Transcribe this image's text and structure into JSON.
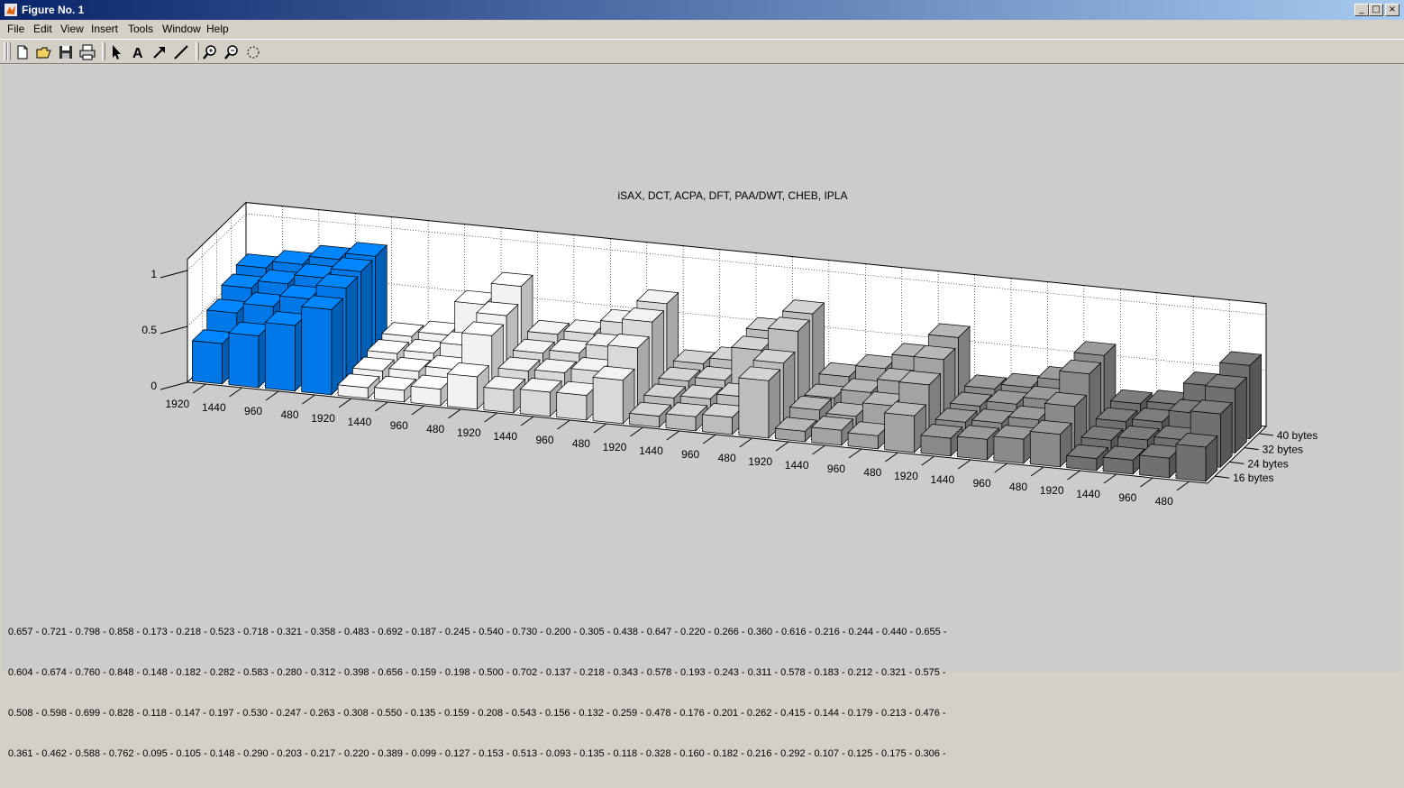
{
  "window": {
    "title": "Figure No. 1"
  },
  "menu": [
    "File",
    "Edit",
    "View",
    "Insert",
    "Tools",
    "Window",
    "Help"
  ],
  "toolbar_icons": [
    "new-icon",
    "open-icon",
    "save-icon",
    "print-icon",
    "arrow-icon",
    "text-icon",
    "arrow-line-icon",
    "line-icon",
    "zoom-in-icon",
    "zoom-out-icon",
    "rotate-icon"
  ],
  "window_buttons": {
    "minimize": "_",
    "maximize": "□",
    "close": "×"
  },
  "colors": {
    "titlebar_start": "#0a246a",
    "titlebar_end": "#a6caf0",
    "highlight_group": "#0078e8",
    "figure_bg": "#cccccc"
  },
  "chart_data": {
    "type": "bar3d",
    "title": "iSAX, DCT, ACPA, DFT, PAA/DWT, CHEB, IPLA",
    "groups": [
      "iSAX",
      "DCT",
      "ACPA",
      "DFT",
      "PAA/DWT",
      "CHEB",
      "IPLA"
    ],
    "group_colors": [
      "#0078e8",
      "#f2f2f2",
      "#d9d9d9",
      "#bdbdbd",
      "#a3a3a3",
      "#8a8a8a",
      "#707070"
    ],
    "x_tick_labels": [
      "1920",
      "1440",
      "960",
      "480"
    ],
    "depth_labels": [
      "16 bytes",
      "24 bytes",
      "32 bytes",
      "40 bytes"
    ],
    "z_ticks": [
      "0",
      "0.5",
      "1"
    ],
    "zlim": [
      0,
      1.1
    ],
    "values": [
      [
        0.361,
        0.462,
        0.588,
        0.762,
        0.095,
        0.105,
        0.148,
        0.29,
        0.203,
        0.217,
        0.22,
        0.389,
        0.099,
        0.127,
        0.153,
        0.513,
        0.093,
        0.135,
        0.118,
        0.328,
        0.16,
        0.182,
        0.216,
        0.292,
        0.107,
        0.125,
        0.175,
        0.306
      ],
      [
        0.508,
        0.598,
        0.699,
        0.828,
        0.118,
        0.147,
        0.197,
        0.53,
        0.247,
        0.263,
        0.308,
        0.55,
        0.135,
        0.159,
        0.208,
        0.543,
        0.156,
        0.132,
        0.259,
        0.478,
        0.176,
        0.201,
        0.262,
        0.415,
        0.144,
        0.179,
        0.213,
        0.476
      ],
      [
        0.604,
        0.674,
        0.76,
        0.848,
        0.148,
        0.182,
        0.282,
        0.583,
        0.28,
        0.312,
        0.398,
        0.656,
        0.159,
        0.198,
        0.5,
        0.702,
        0.137,
        0.218,
        0.343,
        0.578,
        0.193,
        0.243,
        0.311,
        0.578,
        0.183,
        0.212,
        0.321,
        0.575
      ],
      [
        0.657,
        0.721,
        0.798,
        0.858,
        0.173,
        0.218,
        0.523,
        0.718,
        0.321,
        0.358,
        0.483,
        0.692,
        0.187,
        0.245,
        0.54,
        0.73,
        0.2,
        0.305,
        0.438,
        0.647,
        0.22,
        0.266,
        0.36,
        0.616,
        0.216,
        0.244,
        0.44,
        0.655
      ]
    ],
    "text_lines": [
      "0.657 - 0.721 - 0.798 - 0.858 - 0.173 - 0.218 - 0.523 - 0.718 - 0.321 - 0.358 - 0.483 - 0.692 - 0.187 - 0.245 - 0.540 - 0.730 - 0.200 - 0.305 - 0.438 - 0.647 - 0.220 - 0.266 - 0.360 - 0.616 - 0.216 - 0.244 - 0.440 - 0.655 -",
      "0.604 - 0.674 - 0.760 - 0.848 - 0.148 - 0.182 - 0.282 - 0.583 - 0.280 - 0.312 - 0.398 - 0.656 - 0.159 - 0.198 - 0.500 - 0.702 - 0.137 - 0.218 - 0.343 - 0.578 - 0.193 - 0.243 - 0.311 - 0.578 - 0.183 - 0.212 - 0.321 - 0.575 -",
      "0.508 - 0.598 - 0.699 - 0.828 - 0.118 - 0.147 - 0.197 - 0.530 - 0.247 - 0.263 - 0.308 - 0.550 - 0.135 - 0.159 - 0.208 - 0.543 - 0.156 - 0.132 - 0.259 - 0.478 - 0.176 - 0.201 - 0.262 - 0.415 - 0.144 - 0.179 - 0.213 - 0.476 -",
      "0.361 - 0.462 - 0.588 - 0.762 - 0.095 - 0.105 - 0.148 - 0.290 - 0.203 - 0.217 - 0.220 - 0.389 - 0.099 - 0.127 - 0.153 - 0.513 - 0.093 - 0.135 - 0.118 - 0.328 - 0.160 - 0.182 - 0.216 - 0.292 - 0.107 - 0.125 - 0.175 - 0.306 -"
    ]
  }
}
